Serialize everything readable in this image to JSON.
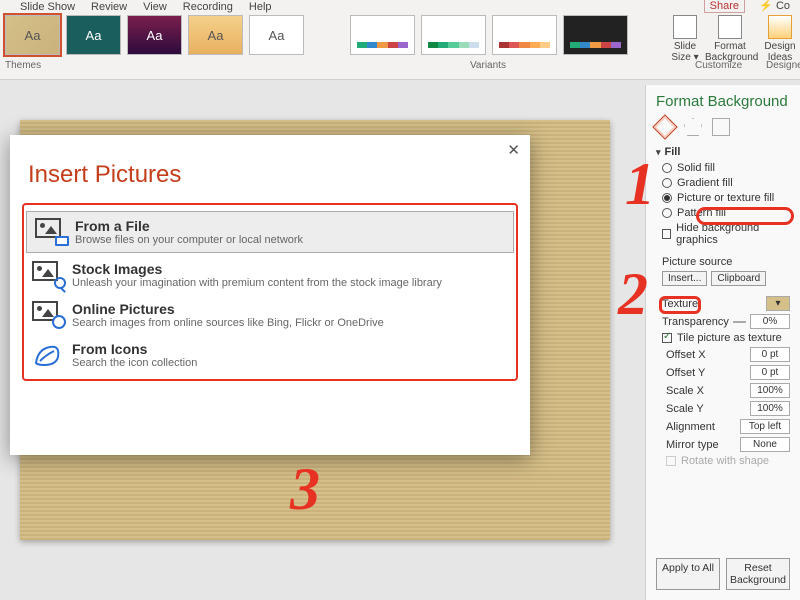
{
  "ribbon": {
    "tabs": [
      "Slide Show",
      "Review",
      "View",
      "Recording",
      "Help"
    ],
    "themes_label": "Themes",
    "variants_label": "Variants",
    "customize_label": "Customize",
    "designer_label": "Designer",
    "btn_size": "Slide\nSize ▾",
    "btn_fmtbg": "Format\nBackground",
    "btn_design": "Design\nIdeas",
    "share": "Share",
    "co": "Co"
  },
  "dialog": {
    "title": "Insert Pictures",
    "close": "✕",
    "options": [
      {
        "title": "From a File",
        "desc": "Browse files on your computer or local network"
      },
      {
        "title": "Stock Images",
        "desc": "Unleash your imagination with premium content from the stock image library"
      },
      {
        "title": "Online Pictures",
        "desc": "Search images from online sources like Bing, Flickr or OneDrive"
      },
      {
        "title": "From Icons",
        "desc": "Search the icon collection"
      }
    ]
  },
  "pane": {
    "title": "Format Background",
    "section_fill": "Fill",
    "fill_opts": {
      "solid": "Solid fill",
      "gradient": "Gradient fill",
      "picture": "Picture or texture fill",
      "pattern": "Pattern fill"
    },
    "hide_bg": "Hide background graphics",
    "pic_source": "Picture source",
    "btn_insert": "Insert...",
    "btn_clip": "Clipboard",
    "texture": "Texture",
    "transparency": "Transparency",
    "transparency_val": "0%",
    "tile": "Tile picture as texture",
    "offx": "Offset X",
    "offx_v": "0 pt",
    "offy": "Offset Y",
    "offy_v": "0 pt",
    "sx": "Scale X",
    "sx_v": "100%",
    "sy": "Scale Y",
    "sy_v": "100%",
    "align": "Alignment",
    "align_v": "Top left",
    "mirror": "Mirror type",
    "mirror_v": "None",
    "rotate": "Rotate with shape",
    "apply_all": "Apply to All",
    "reset": "Reset Background"
  },
  "annotations": {
    "s1": "1",
    "s2": "2",
    "s3": "3"
  }
}
